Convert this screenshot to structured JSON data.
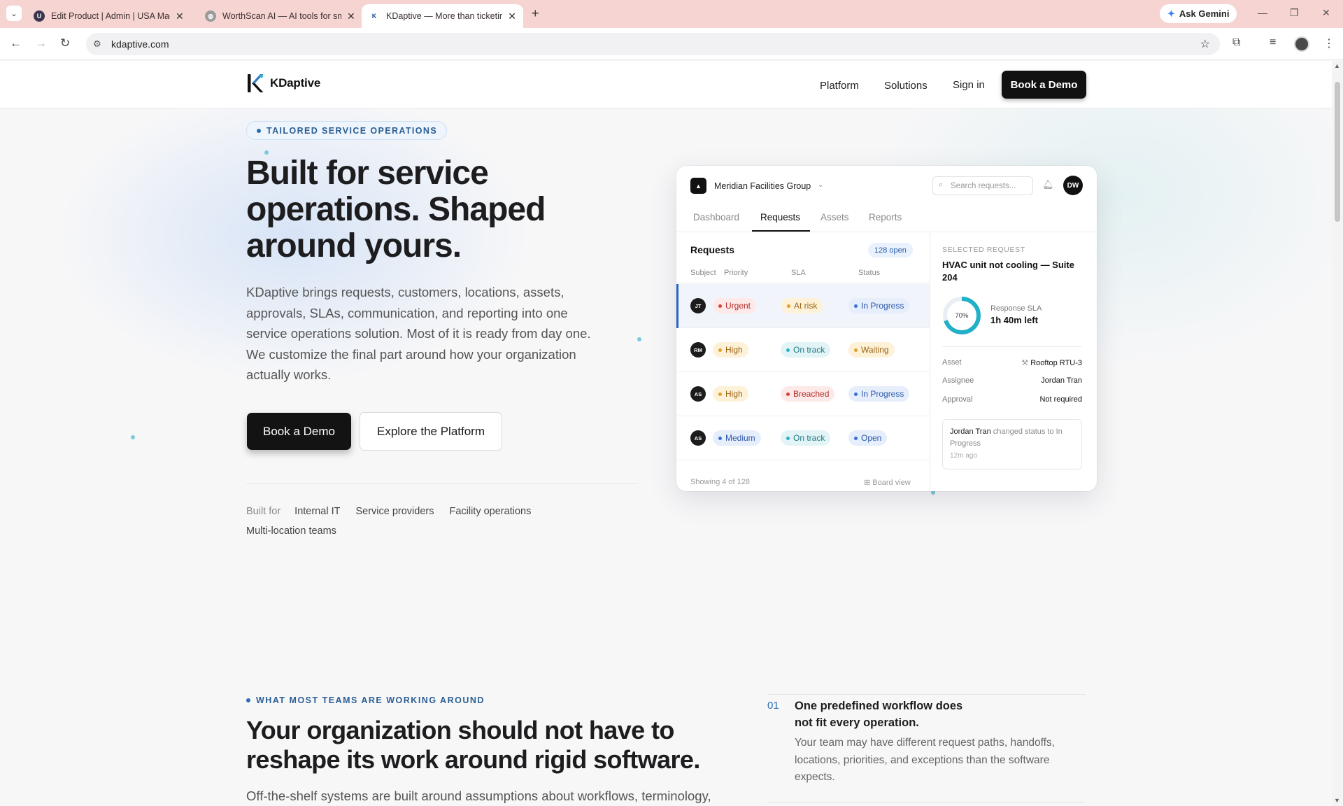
{
  "browser": {
    "tabs": [
      {
        "title": "Edit Product | Admin | USA Made",
        "favicon": "U"
      },
      {
        "title": "WorthScan AI — AI tools for small",
        "favicon": "globe-icon"
      },
      {
        "title": "KDaptive — More than ticketing",
        "favicon": "K"
      }
    ],
    "ask_gemini": "Ask Gemini",
    "url": "kdaptive.com"
  },
  "site": {
    "logo_text": "KDaptive",
    "nav": {
      "platform": "Platform",
      "solutions": "Solutions",
      "sign_in": "Sign in",
      "book_demo": "Book a Demo"
    },
    "colors": {
      "accent": "#2b6cb0",
      "dark": "#111111"
    }
  },
  "hero": {
    "eyebrow": "TAILORED SERVICE OPERATIONS",
    "title": "Built for service operations. Shaped around yours.",
    "body": "KDaptive brings requests, customers, locations, assets, approvals, SLAs, communication, and reporting into one service operations solution. Most of it is ready from day one. We customize the final part around how your organization actually works.",
    "primary_cta": "Book a Demo",
    "secondary_cta": "Explore the Platform",
    "built_for_label": "Built for",
    "built_for": [
      "Internal IT",
      "Service providers",
      "Facility operations",
      "Multi-location teams"
    ]
  },
  "app": {
    "org_name": "Meridian Facilities Group",
    "search_placeholder": "Search requests...",
    "user_initials": "DW",
    "tabs": [
      "Dashboard",
      "Requests",
      "Assets",
      "Reports"
    ],
    "active_tab": "Requests",
    "requests": {
      "title": "Requests",
      "count_badge": "128 open",
      "columns": {
        "subject": "Subject",
        "priority": "Priority",
        "sla": "SLA",
        "status": "Status"
      },
      "rows": [
        {
          "initials": "JT",
          "priority": "Urgent",
          "sla": "At risk",
          "status": "In Progress",
          "selected": true
        },
        {
          "initials": "RM",
          "priority": "High",
          "sla": "On track",
          "status": "Waiting",
          "selected": false
        },
        {
          "initials": "AS",
          "priority": "High",
          "sla": "Breached",
          "status": "In Progress",
          "selected": false
        },
        {
          "initials": "AS",
          "priority": "Medium",
          "sla": "On track",
          "status": "Open",
          "selected": false
        }
      ],
      "footer": "Showing 4 of 128",
      "board_view": "Board view"
    },
    "selected": {
      "label": "SELECTED REQUEST",
      "title": "HVAC unit not cooling — Suite 204",
      "sla_percent_label": "70%",
      "sla_fraction": 0.7,
      "sla_label": "Response SLA",
      "sla_value": "1h 40m left",
      "asset_label": "Asset",
      "asset_value": "Rooftop RTU-3",
      "assignee_label": "Assignee",
      "assignee_value": "Jordan Tran",
      "approval_label": "Approval",
      "approval_value": "Not required",
      "activity_who": "Jordan Tran",
      "activity_text": "changed status to In Progress",
      "activity_time": "12m ago"
    }
  },
  "section2": {
    "eyebrow": "WHAT MOST TEAMS ARE WORKING AROUND",
    "title": "Your organization should not have to reshape its work around rigid software.",
    "body": "Off-the-shelf systems are built around assumptions about workflows, terminology,",
    "feature": {
      "num": "01",
      "title": "One predefined workflow does not fit every operation.",
      "body": "Your team may have different request paths, handoffs, locations, priorities, and exceptions than the software expects."
    }
  }
}
